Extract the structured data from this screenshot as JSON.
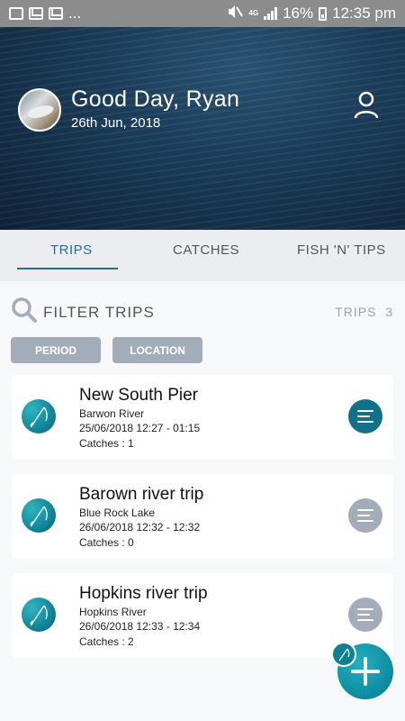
{
  "status_bar": {
    "overflow": "...",
    "network": "4G",
    "battery": "16%",
    "time": "12:35 pm"
  },
  "header": {
    "greeting": "Good Day, Ryan",
    "date": "26th Jun, 2018",
    "icons": [
      "avatar",
      "profile-icon"
    ]
  },
  "tabs": [
    {
      "label": "TRIPS",
      "active": true
    },
    {
      "label": "CATCHES",
      "active": false
    },
    {
      "label": "FISH 'N' TIPS",
      "active": false
    }
  ],
  "filter": {
    "label": "FILTER TRIPS",
    "count_label": "TRIPS",
    "count": "3",
    "chips": [
      "PERIOD",
      "LOCATION"
    ]
  },
  "trips": [
    {
      "title": "New South Pier",
      "location": "Barwon River",
      "time": "25/06/2018  12:27 - 01:15",
      "catches": "Catches : 1",
      "menu_state": "active"
    },
    {
      "title": "Barown river trip",
      "location": "Blue Rock Lake",
      "time": "26/06/2018  12:32 - 12:32",
      "catches": "Catches : 0",
      "menu_state": "inactive"
    },
    {
      "title": "Hopkins river trip",
      "location": "Hopkins River",
      "time": "26/06/2018  12:33 - 12:34",
      "catches": "Catches : 2",
      "menu_state": "inactive"
    }
  ],
  "colors": {
    "accent": "#2b6c97",
    "teal": "#0d8aa0",
    "chip": "#a3adb9"
  }
}
